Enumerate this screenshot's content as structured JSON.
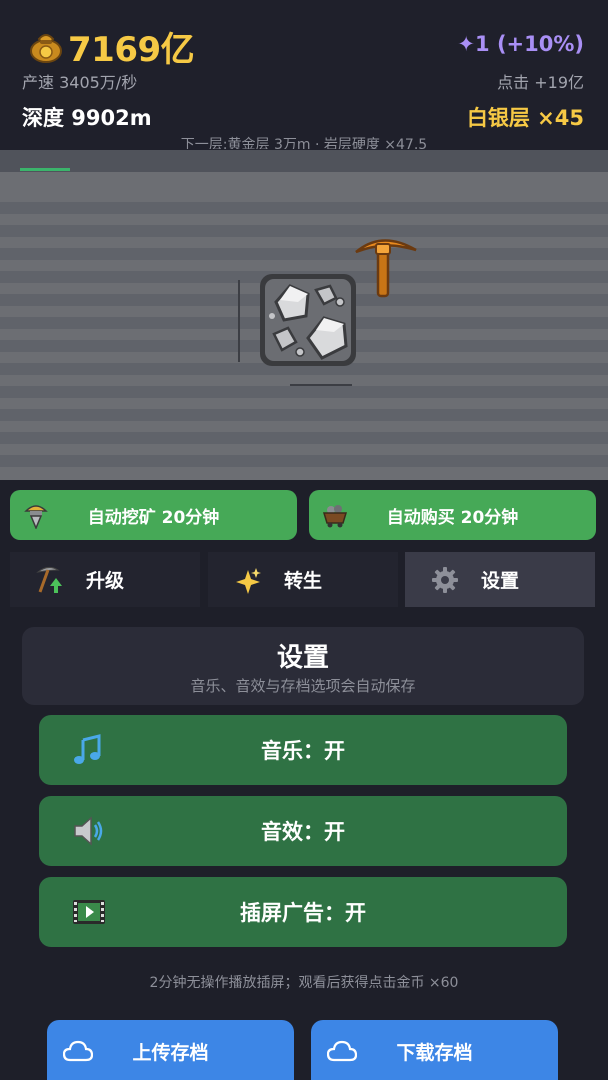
{
  "header": {
    "gold": "7169亿",
    "bonus": "✦1 (+10%)",
    "rate": "产速 3405万/秒",
    "click_value": "点击 +19亿",
    "depth": "深度 9902m",
    "layer": "白银层 ×45",
    "next_layer": "下一层:黄金层 3万m · 岩层硬度 ×47.5"
  },
  "mine": {
    "progress": 0.083
  },
  "boosts": {
    "auto_mine": "自动挖矿 20分钟",
    "auto_buy": "自动购买 20分钟"
  },
  "tabs": {
    "upgrade": "升级",
    "rebirth": "转生",
    "settings": "设置",
    "active": "settings"
  },
  "settings": {
    "title": "设置",
    "subtitle": "音乐、音效与存档选项会自动保存",
    "music": "音乐：开",
    "sfx": "音效：开",
    "interstitial_ads": "插屏广告：开",
    "note": "2分钟无操作播放插屏；观看后获得点击金币 ×60",
    "upload": "上传存档",
    "download": "下载存档"
  },
  "colors": {
    "gold": "#f6c945",
    "bonus": "#a98ff5",
    "green_button": "#46a957",
    "option_green": "#2f7244",
    "blue_button": "#3d86e6"
  },
  "icons": {
    "gold": "gold-bag-icon",
    "pickaxe": "pickaxe-icon",
    "auto_mine": "drill-icon",
    "auto_buy": "mine-cart-icon",
    "upgrade": "pickaxe-up-icon",
    "rebirth": "sparkle-icon",
    "settings": "gear-icon",
    "music": "music-note-icon",
    "sfx": "speaker-icon",
    "ads": "video-icon",
    "cloud": "cloud-icon"
  }
}
